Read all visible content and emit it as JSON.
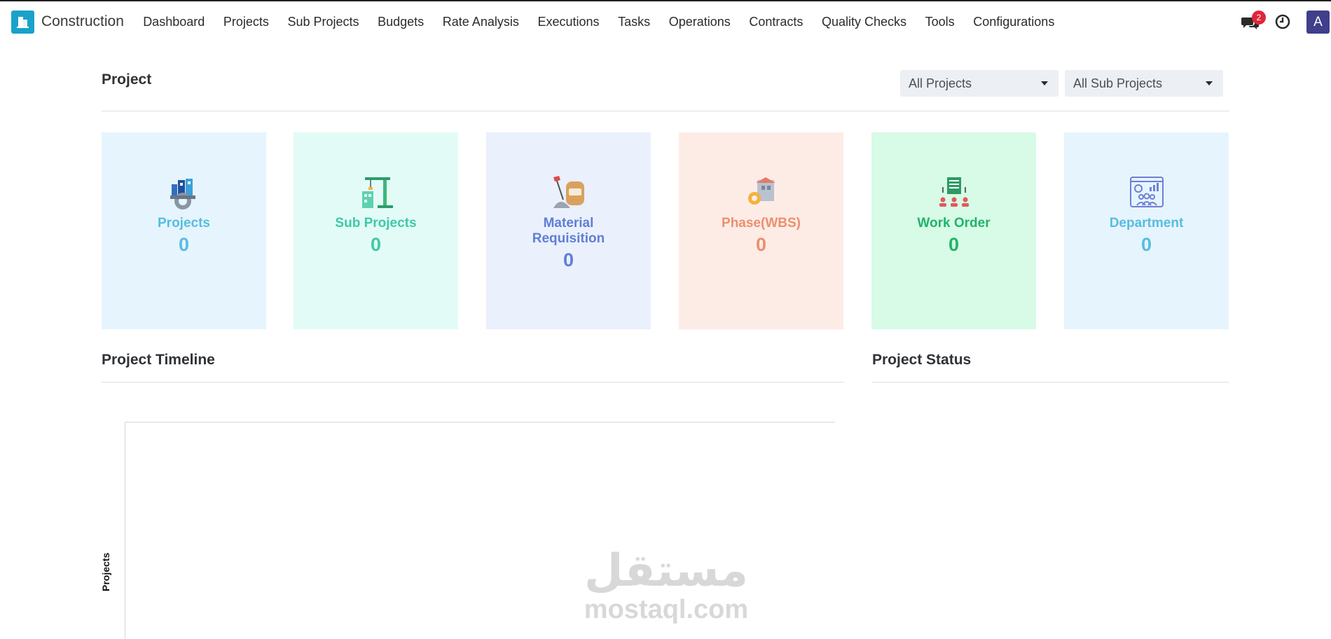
{
  "app": {
    "brand_name": "Construction",
    "brand_color": "#1aa2c8"
  },
  "menu": [
    {
      "label": "Dashboard"
    },
    {
      "label": "Projects"
    },
    {
      "label": "Sub Projects"
    },
    {
      "label": "Budgets"
    },
    {
      "label": "Rate Analysis"
    },
    {
      "label": "Executions"
    },
    {
      "label": "Tasks"
    },
    {
      "label": "Operations"
    },
    {
      "label": "Contracts"
    },
    {
      "label": "Quality Checks"
    },
    {
      "label": "Tools"
    },
    {
      "label": "Configurations"
    }
  ],
  "navbar_right": {
    "messages_icon": "chat-bubbles-icon",
    "messages_count": "2",
    "activity_icon": "clock-icon",
    "avatar_initial": "A"
  },
  "project_section": {
    "title": "Project",
    "filter_projects": "All Projects",
    "filter_sub_projects": "All Sub Projects"
  },
  "cards": [
    {
      "label": "Projects",
      "value": "0",
      "icon": "projects-icon",
      "bg": "#e6f4fd",
      "color": "#56bde0"
    },
    {
      "label": "Sub Projects",
      "value": "0",
      "icon": "crane-icon",
      "bg": "#e3fbf6",
      "color": "#3ec9a7"
    },
    {
      "label": "Material Requisition",
      "value": "0",
      "icon": "cement-bag-icon",
      "bg": "#eaf0fc",
      "color": "#5f7fd4"
    },
    {
      "label": "Phase(WBS)",
      "value": "0",
      "icon": "phase-building-icon",
      "bg": "#fdece6",
      "color": "#ec8f6e"
    },
    {
      "label": "Work Order",
      "value": "0",
      "icon": "work-order-icon",
      "bg": "#d7fbe6",
      "color": "#21b36b"
    },
    {
      "label": "Department",
      "value": "0",
      "icon": "department-icon",
      "bg": "#e6f4fd",
      "color": "#56bde0"
    }
  ],
  "timeline": {
    "title": "Project Timeline",
    "y_axis_label": "Projects"
  },
  "status": {
    "title": "Project Status"
  },
  "watermark": {
    "arabic": "مستقل",
    "latin": "mostaql.com"
  }
}
